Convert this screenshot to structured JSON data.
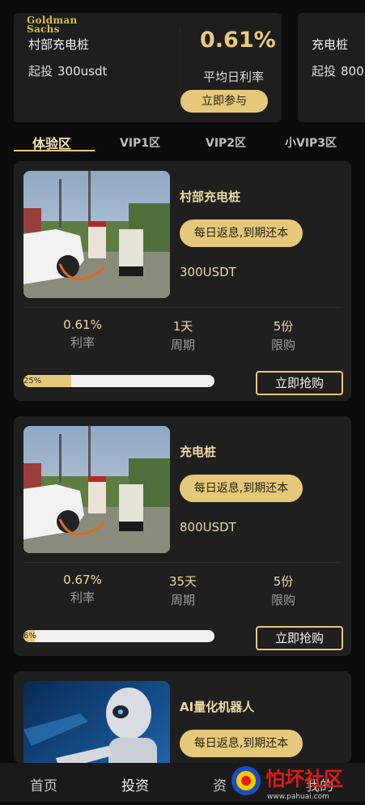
{
  "promo": {
    "logo_line1": "Goldman",
    "logo_line2": "Sachs",
    "name": "村部充电桩",
    "invest_label": "起投",
    "invest_value": "300usdt",
    "rate": "0.61%",
    "rate_label": "平均日利率",
    "button": "立即参与"
  },
  "promo_next": {
    "name": "充电桩",
    "invest_label": "起投",
    "invest_value": "800"
  },
  "tabs": [
    {
      "label": "体验区",
      "active": true
    },
    {
      "label": "VIP1区",
      "active": false
    },
    {
      "label": "VIP2区",
      "active": false
    },
    {
      "label": "小VIP3区",
      "active": false
    }
  ],
  "products": [
    {
      "name": "村部充电桩",
      "tag": "每日返息,到期还本",
      "price": "300USDT",
      "rate": "0.61%",
      "rate_label": "利率",
      "period": "1天",
      "period_label": "周期",
      "limit": "5份",
      "limit_label": "限购",
      "progress": 0.25,
      "progress_text": "25%",
      "button": "立即抢购",
      "image": "charging-station-photo"
    },
    {
      "name": "充电桩",
      "tag": "每日返息,到期还本",
      "price": "800USDT",
      "rate": "0.67%",
      "rate_label": "利率",
      "period": "35天",
      "period_label": "周期",
      "limit": "5份",
      "limit_label": "限购",
      "progress": 0.06,
      "progress_text": "6%",
      "button": "立即抢购",
      "image": "charging-station-photo"
    },
    {
      "name": "AI量化机器人",
      "tag": "每日返息,到期还本",
      "image": "ai-robot-photo"
    }
  ],
  "nav": [
    {
      "label": "首页",
      "active": false
    },
    {
      "label": "投资",
      "active": true
    },
    {
      "label": "资",
      "active": false
    },
    {
      "label": "我的",
      "active": false
    }
  ],
  "watermark": {
    "text": "怕坏社区",
    "url": "www.pahuai.com"
  },
  "colors": {
    "accent": "#e6c87a",
    "background": "#0b0b0b",
    "card": "#1f1f1f"
  }
}
